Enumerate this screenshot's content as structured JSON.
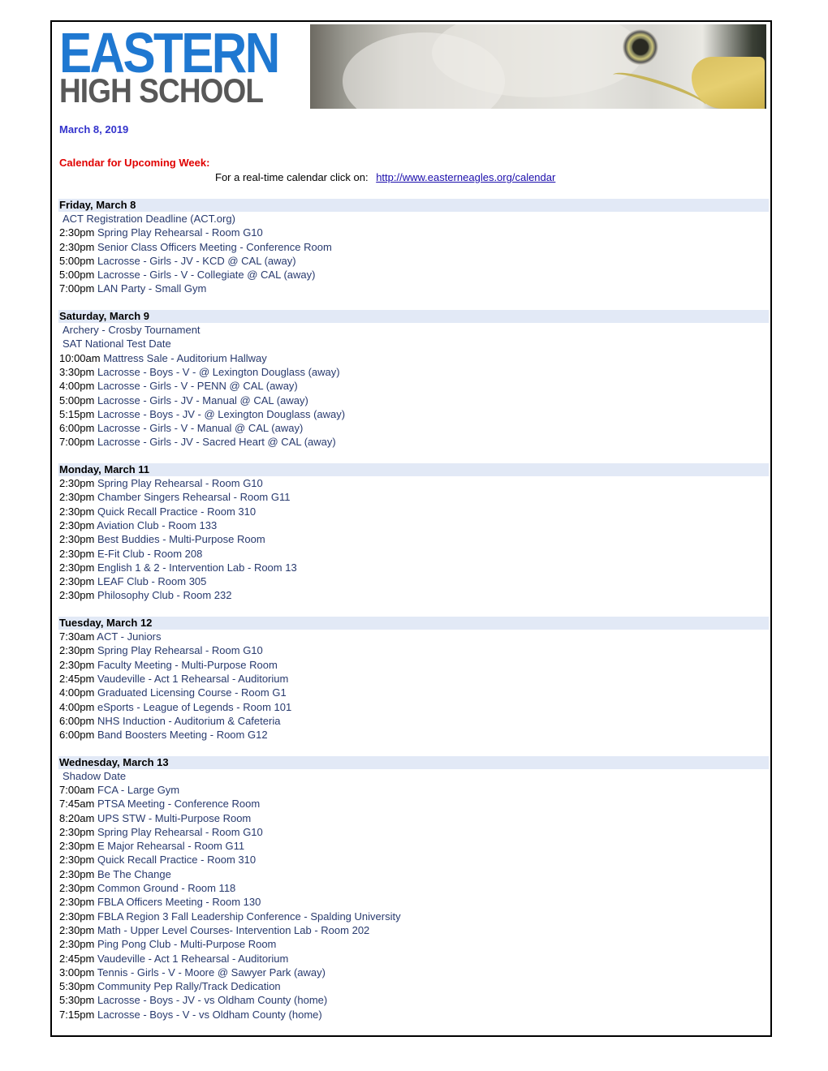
{
  "header": {
    "logo_line1": "EASTERN",
    "logo_line2": "HIGH SCHOOL",
    "banner_image": "bald-eagle-photo"
  },
  "date": "March 8, 2019",
  "calendar": {
    "title": "Calendar for Upcoming Week:",
    "realtime_text": "For a real-time calendar click on:",
    "link": "http://www.easterneagles.org/calendar"
  },
  "colors": {
    "date": "#3333cc",
    "calendar_title": "#e00000",
    "day_header_bg": "#e2e9f6",
    "event_name": "#283a6e",
    "link": "#1a0dab"
  },
  "days": [
    {
      "label": "Friday, March 8",
      "events": [
        {
          "time": "",
          "name": "ACT Registration Deadline (ACT.org)"
        },
        {
          "time": "2:30pm",
          "name": "Spring Play Rehearsal - Room G10"
        },
        {
          "time": "2:30pm",
          "name": "Senior Class Officers Meeting - Conference Room"
        },
        {
          "time": "5:00pm",
          "name": "Lacrosse - Girls - JV - KCD @ CAL (away)"
        },
        {
          "time": "5:00pm",
          "name": "Lacrosse - Girls - V - Collegiate @ CAL (away)"
        },
        {
          "time": "7:00pm",
          "name": "LAN Party - Small Gym"
        }
      ]
    },
    {
      "label": "Saturday, March 9",
      "events": [
        {
          "time": "",
          "name": "Archery - Crosby Tournament"
        },
        {
          "time": "",
          "name": "SAT National Test Date"
        },
        {
          "time": "10:00am",
          "name": "Mattress Sale - Auditorium Hallway"
        },
        {
          "time": "3:30pm",
          "name": "Lacrosse - Boys - V - @ Lexington Douglass (away)"
        },
        {
          "time": "4:00pm",
          "name": "Lacrosse - Girls - V - PENN @ CAL (away)"
        },
        {
          "time": "5:00pm",
          "name": "Lacrosse - Girls - JV - Manual @ CAL (away)"
        },
        {
          "time": "5:15pm",
          "name": "Lacrosse - Boys - JV - @ Lexington Douglass (away)"
        },
        {
          "time": "6:00pm",
          "name": "Lacrosse - Girls - V - Manual @ CAL (away)"
        },
        {
          "time": "7:00pm",
          "name": "Lacrosse - Girls - JV - Sacred Heart @ CAL (away)"
        }
      ]
    },
    {
      "label": "Monday, March 11",
      "events": [
        {
          "time": "2:30pm",
          "name": "Spring Play Rehearsal - Room G10"
        },
        {
          "time": "2:30pm",
          "name": "Chamber Singers Rehearsal - Room G11"
        },
        {
          "time": "2:30pm",
          "name": "Quick Recall Practice - Room 310"
        },
        {
          "time": "2:30pm",
          "name": "Aviation Club - Room 133"
        },
        {
          "time": "2:30pm",
          "name": "Best Buddies - Multi-Purpose Room"
        },
        {
          "time": "2:30pm",
          "name": "E-Fit Club - Room 208"
        },
        {
          "time": "2:30pm",
          "name": "English 1 & 2 - Intervention Lab - Room 13"
        },
        {
          "time": "2:30pm",
          "name": "LEAF Club - Room 305"
        },
        {
          "time": "2:30pm",
          "name": "Philosophy Club - Room 232"
        }
      ]
    },
    {
      "label": "Tuesday, March 12",
      "events": [
        {
          "time": "7:30am",
          "name": "ACT - Juniors"
        },
        {
          "time": "2:30pm",
          "name": "Spring Play Rehearsal - Room G10"
        },
        {
          "time": "2:30pm",
          "name": "Faculty Meeting - Multi-Purpose Room"
        },
        {
          "time": "2:45pm",
          "name": "Vaudeville - Act 1 Rehearsal - Auditorium"
        },
        {
          "time": "4:00pm",
          "name": "Graduated Licensing Course - Room G1"
        },
        {
          "time": "4:00pm",
          "name": "eSports - League of Legends - Room 101"
        },
        {
          "time": "6:00pm",
          "name": "NHS Induction - Auditorium & Cafeteria"
        },
        {
          "time": "6:00pm",
          "name": "Band Boosters Meeting - Room G12"
        }
      ]
    },
    {
      "label": "Wednesday, March 13",
      "events": [
        {
          "time": "",
          "name": "Shadow Date"
        },
        {
          "time": "7:00am",
          "name": "FCA - Large Gym"
        },
        {
          "time": "7:45am",
          "name": "PTSA Meeting - Conference Room"
        },
        {
          "time": "8:20am",
          "name": "UPS STW - Multi-Purpose Room"
        },
        {
          "time": "2:30pm",
          "name": "Spring Play Rehearsal - Room G10"
        },
        {
          "time": "2:30pm",
          "name": "E Major Rehearsal - Room G11"
        },
        {
          "time": "2:30pm",
          "name": "Quick Recall Practice - Room 310"
        },
        {
          "time": "2:30pm",
          "name": "Be The Change"
        },
        {
          "time": "2:30pm",
          "name": "Common Ground - Room 118"
        },
        {
          "time": "2:30pm",
          "name": "FBLA Officers Meeting - Room 130"
        },
        {
          "time": "2:30pm",
          "name": "FBLA Region 3 Fall Leadership Conference - Spalding University"
        },
        {
          "time": "2:30pm",
          "name": "Math - Upper Level Courses- Intervention Lab - Room 202"
        },
        {
          "time": "2:30pm",
          "name": "Ping Pong Club - Multi-Purpose Room"
        },
        {
          "time": "2:45pm",
          "name": "Vaudeville - Act 1 Rehearsal - Auditorium"
        },
        {
          "time": "3:00pm",
          "name": "Tennis - Girls - V - Moore @ Sawyer Park (away)"
        },
        {
          "time": "5:30pm",
          "name": "Community Pep Rally/Track Dedication"
        },
        {
          "time": "5:30pm",
          "name": "Lacrosse - Boys - JV - vs Oldham County (home)"
        },
        {
          "time": "7:15pm",
          "name": "Lacrosse - Boys - V - vs Oldham County (home)"
        }
      ]
    }
  ]
}
